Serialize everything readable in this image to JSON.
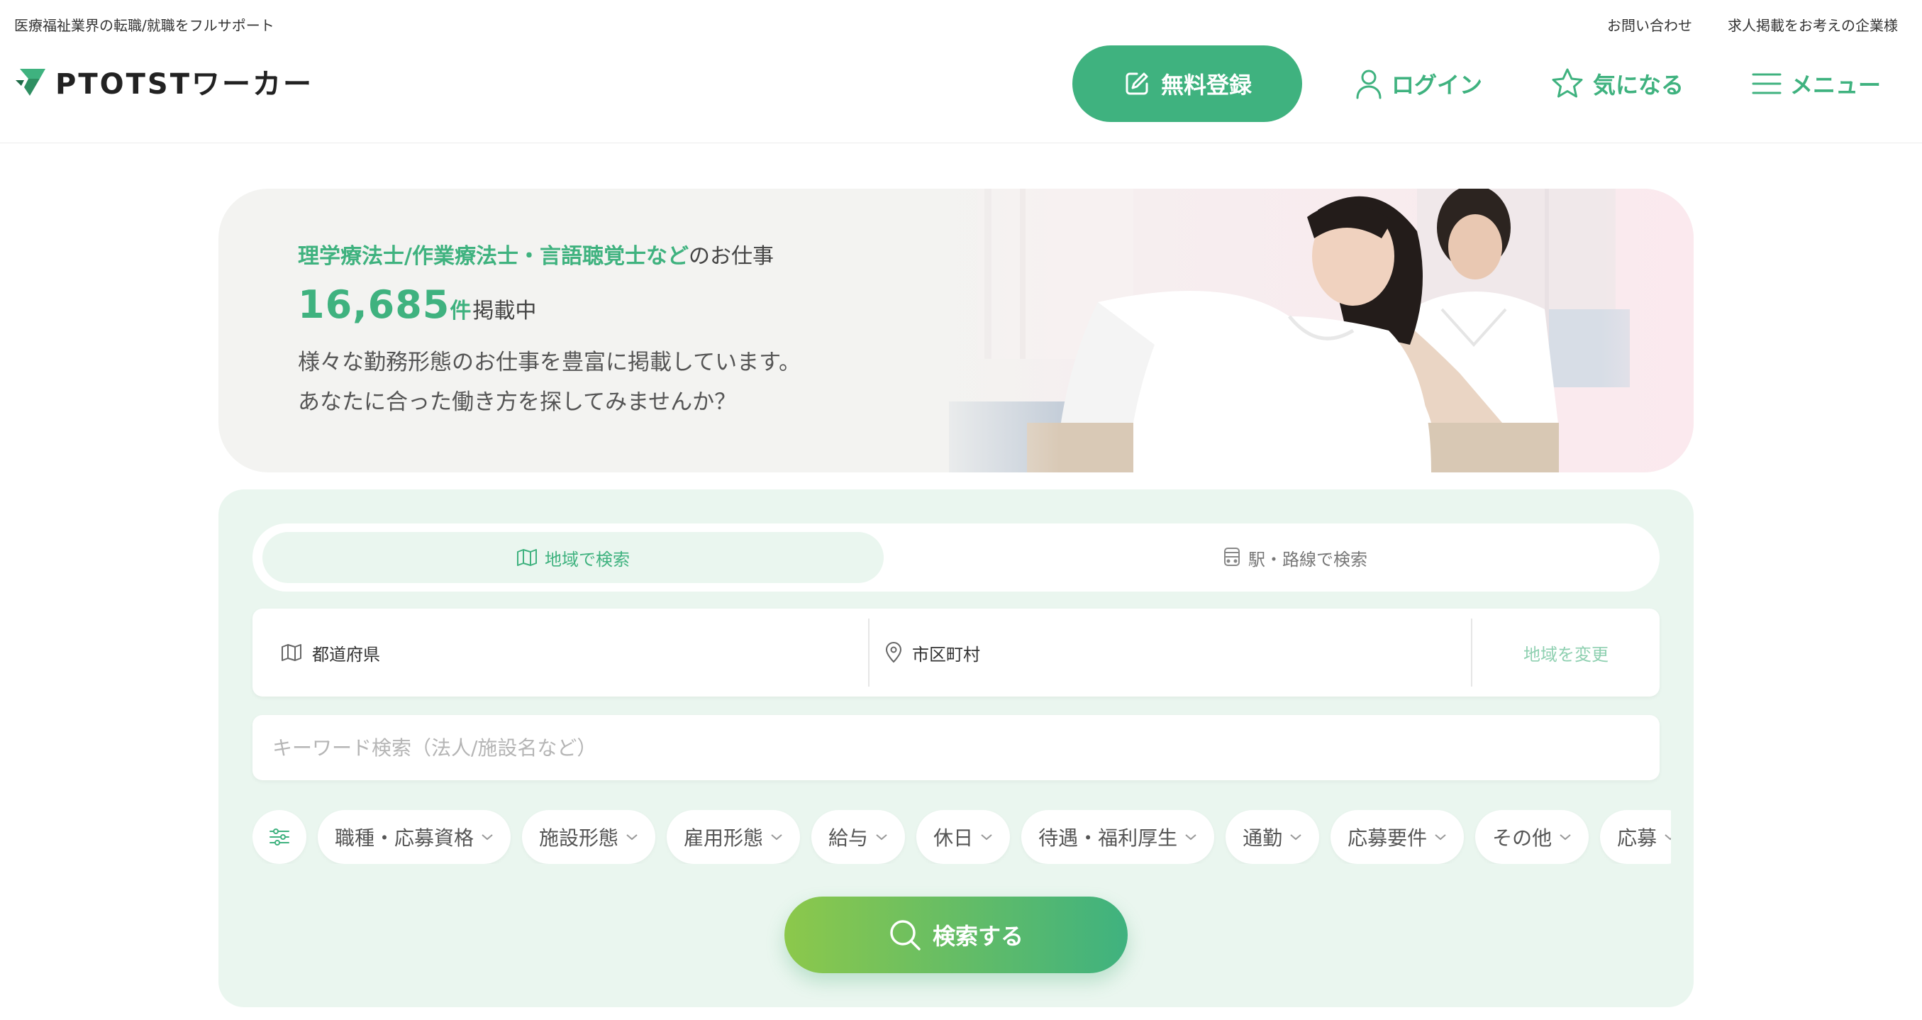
{
  "topbar": {
    "tagline": "医療福祉業界の転職/就職をフルサポート",
    "links": [
      "お問い合わせ",
      "求人掲載をお考えの企業様"
    ]
  },
  "header": {
    "logo_text": "PTOTSTワーカー",
    "register_label": "無料登録",
    "login_label": "ログイン",
    "favorite_label": "気になる",
    "menu_label": "メニュー"
  },
  "hero": {
    "line1_accent": "理学療法士/作業療法士・言語聴覚士など",
    "line1_tail": "のお仕事",
    "count": "16,685",
    "count_unit": "件",
    "count_tail": "掲載中",
    "desc1": "様々な勤務形態のお仕事を豊富に掲載しています。",
    "desc2": "あなたに合った働き方を探してみませんか？"
  },
  "search": {
    "tab_area": "地域で検索",
    "tab_station": "駅・路線で検索",
    "prefecture": "都道府県",
    "city": "市区町村",
    "change_area": "地域を変更",
    "keyword_placeholder": "キーワード検索（法人/施設名など）",
    "filters": [
      "職種・応募資格",
      "施設形態",
      "雇用形態",
      "給与",
      "休日",
      "待遇・福利厚生",
      "通勤",
      "応募要件",
      "その他",
      "応募"
    ],
    "submit": "検索する"
  },
  "colors": {
    "accent": "#3fb27f",
    "panel_bg": "#eaf6ef",
    "hero_bg": "#f3f3f1",
    "gradient_start": "#8cc84b"
  }
}
